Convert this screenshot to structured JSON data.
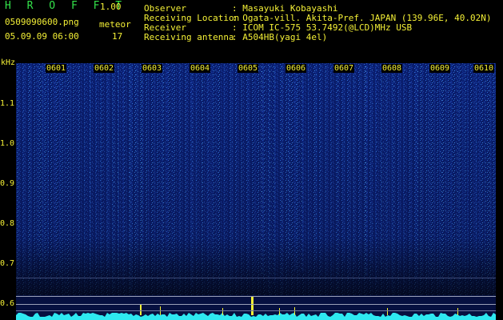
{
  "header": {
    "app_title": "H R O F F T",
    "version": "1.00",
    "filename": "0509090600.png",
    "meteor_label": "meteor",
    "datetime": "05.09.09 06:00",
    "meteor_count": "17",
    "fields": [
      {
        "label": "Observer",
        "value": ": Masayuki Kobayashi"
      },
      {
        "label": "Receiving Location",
        "value": ": Ogata-vill. Akita-Pref. JAPAN (139.96E, 40.02N)"
      },
      {
        "label": "Receiver",
        "value": ": ICOM IC-575 53.7492(@LCD)MHz USB"
      },
      {
        "label": "Receiving antenna",
        "value": ": A504HB(yagi 4el)"
      }
    ]
  },
  "axis": {
    "unit": "kHz",
    "y_ticks": [
      "1.1",
      "1.0",
      "0.9",
      "0.8",
      "0.7",
      "0.6"
    ],
    "x_ticks": [
      "0601",
      "0602",
      "0603",
      "0604",
      "0605",
      "0606",
      "0607",
      "0608",
      "0609",
      "0610"
    ]
  },
  "colors": {
    "green": "#33e24a",
    "yellow": "#f4f036",
    "spectrum_blue": "#1a3da8",
    "baseline_cyan": "#2ee8f0"
  }
}
